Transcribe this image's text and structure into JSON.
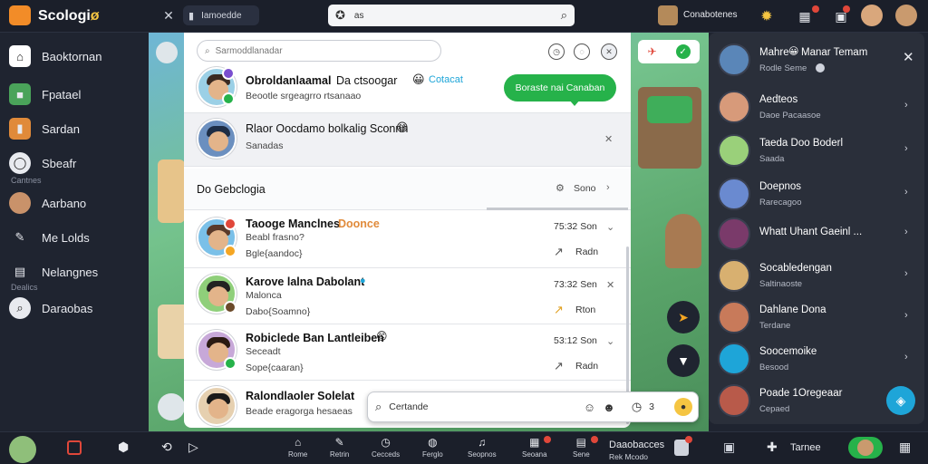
{
  "app": {
    "name_main": "Scologi",
    "name_accent": "ø"
  },
  "top": {
    "pill_label": "Iamoedde",
    "search_placeholder": "as",
    "user_label": "Conabotenes"
  },
  "sidebar": {
    "items": [
      {
        "label": "Baoktornan",
        "icon": "home-icon"
      },
      {
        "label": "Fpatael",
        "icon": "cube-icon"
      },
      {
        "label": "Sardan",
        "icon": "bag-icon"
      },
      {
        "label": "Sbeafr",
        "icon": "chat-icon"
      },
      {
        "label": "Aarbano",
        "icon": "avatar-icon"
      },
      {
        "label": "Me Lolds",
        "icon": "wrench-icon"
      },
      {
        "label": "Nelangnes",
        "icon": "doc-icon"
      },
      {
        "label": "Daraobas",
        "icon": "search-icon"
      }
    ],
    "subs": [
      "Cantnes",
      "Dealics"
    ]
  },
  "panel": {
    "search_placeholder": "Sarmoddlanadar",
    "header_name": "Obroldanlaamal",
    "header_extra": "Da ctsoogar",
    "header_sub": "Beootle srgeagrro rtsanaao",
    "header_tag": "Cotacat",
    "bubble": "Boraste nai Canaban",
    "row1_name": "Rlaor Oocdamo bolkalig Sconnn",
    "row1_sub": "Sanadas",
    "section_title": "Do Gebclogia",
    "section_right": "Sono",
    "chats": [
      {
        "name": "Taooge Manclnes",
        "extra": "Doonce",
        "sub1": "Beabl frasno?",
        "sub2": "Bgle{aandoc}",
        "time": "75:32 Son",
        "action": "Radn"
      },
      {
        "name": "Karove lalna Dabolant",
        "extra": "",
        "sub1": "Malonca",
        "sub2": "Dabo{Soamno}",
        "time": "73:32 Sen",
        "action": "Rton"
      },
      {
        "name": "Robiclede Ban Lantleiben",
        "extra": "",
        "sub1": "Seceadt",
        "sub2": "Sope{caaran}",
        "time": "53:12 Son",
        "action": "Radn"
      },
      {
        "name": "Ralondlaoler Solelat",
        "extra": "",
        "sub1": "Beade eragorga hesaeas",
        "sub2": "",
        "time": "",
        "action": ""
      }
    ],
    "compose_placeholder": "Certande",
    "compose_count": "3"
  },
  "right": {
    "header_name": "Mahre",
    "header_name2": "Manar Temam",
    "header_sub": "Rodle Seme",
    "contacts": [
      {
        "name": "Aedteos",
        "sub": "Daoe Pacaasoe"
      },
      {
        "name": "Taeda Doo Boderl",
        "sub": "Saada"
      },
      {
        "name": "Doepnos",
        "sub": "Rarecagoo"
      },
      {
        "name": "Whatt Uhant Gaeinl ...",
        "sub": ""
      },
      {
        "name": "Socabledengan",
        "sub": "Saltinaoste"
      },
      {
        "name": "Dahlane Dona",
        "sub": "Terdane"
      },
      {
        "name": "Soocemoike",
        "sub": "Besood"
      },
      {
        "name": "Poade 1Oregeaar",
        "sub": "Cepaed"
      }
    ]
  },
  "bottom": {
    "items": [
      {
        "label": "Rome",
        "icon": "home-icon"
      },
      {
        "label": "Retrin",
        "icon": "edit-icon"
      },
      {
        "label": "Cecceds",
        "icon": "clock-icon"
      },
      {
        "label": "Ferglo",
        "icon": "globe-icon"
      },
      {
        "label": "Seopnos",
        "icon": "music-icon"
      },
      {
        "label": "Seoana",
        "icon": "gift-icon"
      },
      {
        "label": "Sene",
        "icon": "store-icon"
      }
    ],
    "extra_title": "Daaobacces",
    "extra_sub": "Rek Mcodo",
    "user_label": "Tarnee"
  },
  "colors": {
    "accent_green": "#26b24a",
    "brand_orange": "#f28c28",
    "notify_red": "#e0473a",
    "bg_dark": "#1f2430"
  }
}
